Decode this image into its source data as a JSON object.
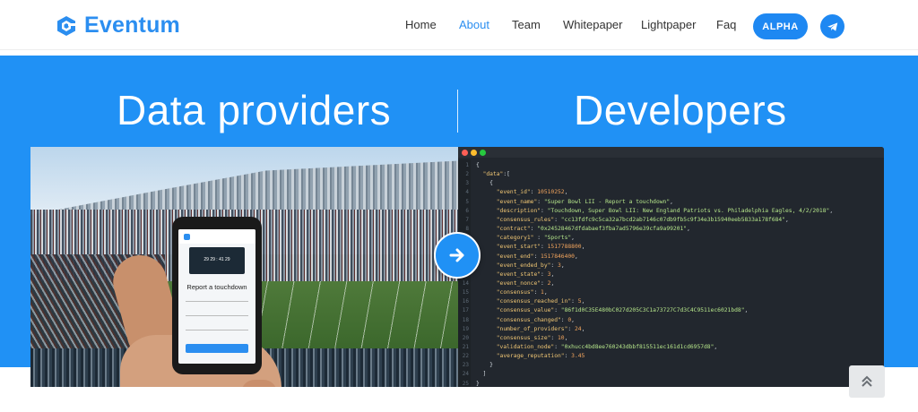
{
  "brand": {
    "name": "Eventum",
    "color": "#2b8ef0"
  },
  "nav": {
    "items": [
      {
        "label": "Home",
        "active": false
      },
      {
        "label": "About",
        "active": true
      },
      {
        "label": "Team",
        "active": false
      },
      {
        "label": "Whitepaper",
        "active": false
      },
      {
        "label": "Lightpaper",
        "active": false
      },
      {
        "label": "Faq",
        "active": false
      }
    ],
    "cta_label": "ALPHA",
    "telegram_icon": "telegram-icon"
  },
  "hero": {
    "left_title": "Data providers",
    "right_title": "Developers",
    "background": "#2091f5",
    "phone_screen": {
      "title": "Report a touchdown",
      "score": "29  29 : 41  29"
    }
  },
  "code": {
    "lines": [
      {
        "n": "1",
        "parts": [
          [
            "p",
            "{"
          ]
        ]
      },
      {
        "n": "2",
        "parts": [
          [
            "p",
            "  "
          ],
          [
            "k",
            "\"data\""
          ],
          [
            "p",
            ":["
          ]
        ]
      },
      {
        "n": "3",
        "parts": [
          [
            "p",
            "    {"
          ]
        ]
      },
      {
        "n": "4",
        "parts": [
          [
            "p",
            "      "
          ],
          [
            "k",
            "\"event_id\""
          ],
          [
            "p",
            ": "
          ],
          [
            "n",
            "10510252"
          ],
          [
            "p",
            ","
          ]
        ]
      },
      {
        "n": "5",
        "parts": [
          [
            "p",
            "      "
          ],
          [
            "k",
            "\"event_name\""
          ],
          [
            "p",
            ": "
          ],
          [
            "s",
            "\"Super Bowl LII - Report a touchdown\""
          ],
          [
            "p",
            ","
          ]
        ]
      },
      {
        "n": "6",
        "parts": [
          [
            "p",
            "      "
          ],
          [
            "k",
            "\"description\""
          ],
          [
            "p",
            ": "
          ],
          [
            "s",
            "\"Touchdown, Super Bowl LII: New England Patriots vs. Philadelphia Eagles, 4/2/2018\""
          ],
          [
            "p",
            ","
          ]
        ]
      },
      {
        "n": "7",
        "parts": [
          [
            "p",
            "      "
          ],
          [
            "k",
            "\"consensus_rules\""
          ],
          [
            "p",
            ": "
          ],
          [
            "s",
            "\"cc13fdfc9c5ca32a7bcd2ab7146c07db9fb5c9f34e3b15940eeb5833a178f684\""
          ],
          [
            "p",
            ","
          ]
        ]
      },
      {
        "n": "8",
        "parts": [
          [
            "p",
            "      "
          ],
          [
            "k",
            "\"contract\""
          ],
          [
            "p",
            ": "
          ],
          [
            "s",
            "\"0x24528467dfdabaef3fba7ad5796e39cfa9a99201\""
          ],
          [
            "p",
            ","
          ]
        ]
      },
      {
        "n": "9",
        "parts": [
          [
            "p",
            "      "
          ],
          [
            "k",
            "\"category1\""
          ],
          [
            "p",
            " : "
          ],
          [
            "s",
            "\"Sports\""
          ],
          [
            "p",
            ","
          ]
        ]
      },
      {
        "n": "10",
        "parts": [
          [
            "p",
            "      "
          ],
          [
            "k",
            "\"event_start\""
          ],
          [
            "p",
            ": "
          ],
          [
            "n",
            "1517788800"
          ],
          [
            "p",
            ","
          ]
        ]
      },
      {
        "n": "11",
        "parts": [
          [
            "p",
            "      "
          ],
          [
            "k",
            "\"event_end\""
          ],
          [
            "p",
            ": "
          ],
          [
            "n",
            "1517846400"
          ],
          [
            "p",
            ","
          ]
        ]
      },
      {
        "n": "12",
        "parts": [
          [
            "p",
            "      "
          ],
          [
            "k",
            "\"event_ended_by\""
          ],
          [
            "p",
            ": "
          ],
          [
            "n",
            "3"
          ],
          [
            "p",
            ","
          ]
        ]
      },
      {
        "n": "13",
        "parts": [
          [
            "p",
            "      "
          ],
          [
            "k",
            "\"event_state\""
          ],
          [
            "p",
            ": "
          ],
          [
            "n",
            "3"
          ],
          [
            "p",
            ","
          ]
        ]
      },
      {
        "n": "14",
        "parts": [
          [
            "p",
            "      "
          ],
          [
            "k",
            "\"event_nonce\""
          ],
          [
            "p",
            ": "
          ],
          [
            "n",
            "2"
          ],
          [
            "p",
            ","
          ]
        ]
      },
      {
        "n": "15",
        "parts": [
          [
            "p",
            "      "
          ],
          [
            "k",
            "\"consensus\""
          ],
          [
            "p",
            ": "
          ],
          [
            "n",
            "1"
          ],
          [
            "p",
            ","
          ]
        ]
      },
      {
        "n": "16",
        "parts": [
          [
            "p",
            "      "
          ],
          [
            "k",
            "\"consensus_reached_in\""
          ],
          [
            "p",
            ": "
          ],
          [
            "n",
            "5"
          ],
          [
            "p",
            ","
          ]
        ]
      },
      {
        "n": "17",
        "parts": [
          [
            "p",
            "      "
          ],
          [
            "k",
            "\"consensus_value\""
          ],
          [
            "p",
            ": "
          ],
          [
            "s",
            "\"86f1d0C35E480bC027d205C3C1a73727C7d3C4C9511ec6021bd8\""
          ],
          [
            "p",
            ","
          ]
        ]
      },
      {
        "n": "18",
        "parts": [
          [
            "p",
            "      "
          ],
          [
            "k",
            "\"consensus_changed\""
          ],
          [
            "p",
            ": "
          ],
          [
            "n",
            "0"
          ],
          [
            "p",
            ","
          ]
        ]
      },
      {
        "n": "19",
        "parts": [
          [
            "p",
            "      "
          ],
          [
            "k",
            "\"number_of_providers\""
          ],
          [
            "p",
            ": "
          ],
          [
            "n",
            "24"
          ],
          [
            "p",
            ","
          ]
        ]
      },
      {
        "n": "20",
        "parts": [
          [
            "p",
            "      "
          ],
          [
            "k",
            "\"consensus_size\""
          ],
          [
            "p",
            ": "
          ],
          [
            "n",
            "10"
          ],
          [
            "p",
            ","
          ]
        ]
      },
      {
        "n": "21",
        "parts": [
          [
            "p",
            "      "
          ],
          [
            "k",
            "\"validation_node\""
          ],
          [
            "p",
            ": "
          ],
          [
            "s",
            "\"0xhucc4bd8ee760243dbbf815511ec161d1cd6957d8\""
          ],
          [
            "p",
            ","
          ]
        ]
      },
      {
        "n": "22",
        "parts": [
          [
            "p",
            "      "
          ],
          [
            "k",
            "\"average_reputation\""
          ],
          [
            "p",
            ": "
          ],
          [
            "n",
            "3.45"
          ]
        ]
      },
      {
        "n": "23",
        "parts": [
          [
            "p",
            "    }"
          ]
        ]
      },
      {
        "n": "24",
        "parts": [
          [
            "p",
            "  ]"
          ]
        ]
      },
      {
        "n": "25",
        "parts": [
          [
            "p",
            "}"
          ]
        ]
      }
    ]
  },
  "icons": {
    "arrow": "arrow-right-icon",
    "scroll_top": "chevron-double-up-icon"
  }
}
